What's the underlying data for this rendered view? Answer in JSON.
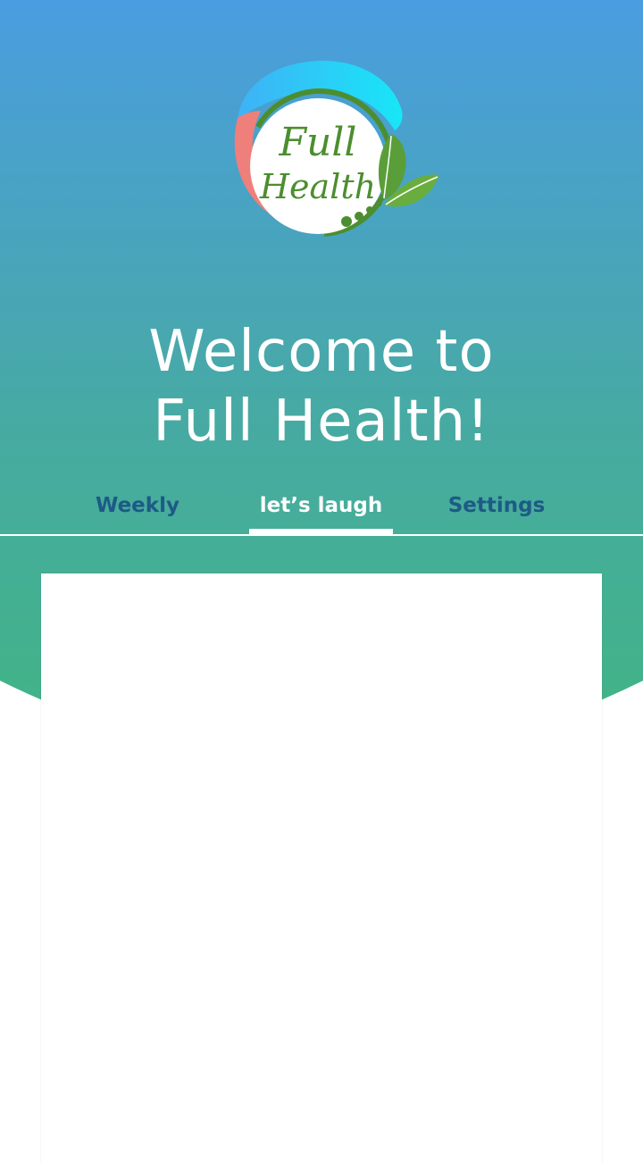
{
  "header": {
    "logo": {
      "name": "full-health-logo",
      "text_line1": "Full",
      "text_line2": "Health"
    },
    "title_line1": "Welcome to",
    "title_line2": "Full Health!"
  },
  "tabs": [
    {
      "label": "Weekly",
      "active": false
    },
    {
      "label": "let’s laugh",
      "active": true
    },
    {
      "label": "Settings",
      "active": false
    }
  ],
  "colors": {
    "gradient_top": "#4a9de0",
    "gradient_bottom": "#41b583",
    "tab_inactive": "#1e5a86",
    "tab_active": "#ffffff",
    "logo_green": "#4c8e2f",
    "logo_cyan": "#22d6f5",
    "logo_salmon": "#ef7f7a"
  }
}
